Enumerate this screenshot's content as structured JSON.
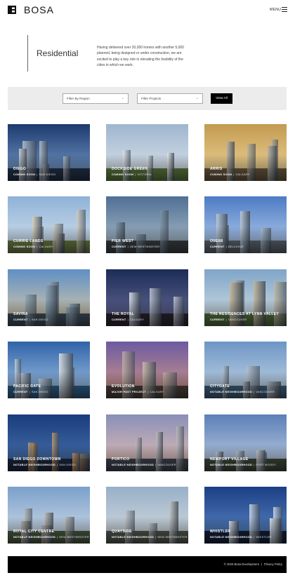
{
  "brand": {
    "logo_text": "BOSA"
  },
  "header": {
    "menu_label": "MENU"
  },
  "intro": {
    "title": "Residential",
    "text": "Having delivered over 20,000 homes with another 5,000 planned, being designed or under construction, we are excited to play a key role in elevating the livability of the cities in which we work."
  },
  "filters": {
    "region_placeholder": "Filter By Region",
    "projects_placeholder": "Filter Projects",
    "view_all_label": "View All"
  },
  "projects": [
    {
      "name": "DIEGO",
      "status": "COMING SOON",
      "city": "SAN DIEGO",
      "palette": {
        "sky_top": "#1d3a6e",
        "sky_bottom": "#7ea3cf",
        "building": "#c9cfd6",
        "ground": "#24324a"
      }
    },
    {
      "name": "DOCKSIDE GREEN",
      "status": "COMING SOON",
      "city": "VICTORIA",
      "palette": {
        "sky_top": "#9fb6cf",
        "sky_bottom": "#dfe6ec",
        "building": "#e7eaec",
        "ground": "#5d7a3f"
      }
    },
    {
      "name": "ARRIS",
      "status": "COMING SOON",
      "city": "CALGARY",
      "palette": {
        "sky_top": "#c39a4f",
        "sky_bottom": "#f1d9a0",
        "building": "#b7b2a5",
        "ground": "#6a5a3f"
      }
    },
    {
      "name": "CURRIE LANDS",
      "status": "COMING SOON",
      "city": "CALGARY",
      "palette": {
        "sky_top": "#8fb2d8",
        "sky_bottom": "#d7e4ee",
        "building": "#d8d1c0",
        "ground": "#6a7d45"
      }
    },
    {
      "name": "PIER WEST",
      "status": "CURRENT",
      "city": "NEW WESTMINSTER",
      "palette": {
        "sky_top": "#4f6f94",
        "sky_bottom": "#b4c3cf",
        "building": "#7f94a8",
        "ground": "#3b3f43"
      }
    },
    {
      "name": "ONE88",
      "status": "CURRENT",
      "city": "BELLEVUE",
      "palette": {
        "sky_top": "#4d7bc4",
        "sky_bottom": "#bcd3ee",
        "building": "#b8c8d8",
        "ground": "#5d6670"
      }
    },
    {
      "name": "SAVINA",
      "status": "CURRENT",
      "city": "SAN DIEGO",
      "palette": {
        "sky_top": "#5f8fc4",
        "sky_bottom": "#e4cfa6",
        "building": "#8aa2b4",
        "ground": "#3d4b58"
      }
    },
    {
      "name": "THE ROYAL",
      "status": "CURRENT",
      "city": "CALGARY",
      "palette": {
        "sky_top": "#1c2c56",
        "sky_bottom": "#6b6f9a",
        "building": "#d4d9e6",
        "ground": "#2b2430"
      }
    },
    {
      "name": "THE RESIDENCES AT LYNN VALLEY",
      "status": "CURRENT",
      "city": "VANCOUVER",
      "palette": {
        "sky_top": "#7fa5c8",
        "sky_bottom": "#d9e2e4",
        "building": "#c4b8a0",
        "ground": "#4f6b3c"
      }
    },
    {
      "name": "PACIFIC GATE",
      "status": "CURRENT",
      "city": "SAN DIEGO",
      "palette": {
        "sky_top": "#2f63a8",
        "sky_bottom": "#a9c9e8",
        "building": "#d6dee6",
        "ground": "#2e5c86"
      }
    },
    {
      "name": "EVOLUTION",
      "status": "MAJOR PAST PROJECT",
      "city": "CALGARY",
      "palette": {
        "sky_top": "#6c5aa1",
        "sky_bottom": "#d89b86",
        "building": "#c7b8aa",
        "ground": "#4a3e3a"
      }
    },
    {
      "name": "CITYGATE",
      "status": "NOTABLE NEIGHBOURHOOD",
      "city": "VANCOUVER",
      "palette": {
        "sky_top": "#6d96c6",
        "sky_bottom": "#c9d9e6",
        "building": "#b8c0c8",
        "ground": "#3d5e7a"
      }
    },
    {
      "name": "SAN DIEGO DOWNTOWN",
      "status": "NOTABLE NEIGHBOURHOOD",
      "city": "SAN DIEGO",
      "palette": {
        "sky_top": "#1a3c7c",
        "sky_bottom": "#4d78b2",
        "building": "#d9a66b",
        "ground": "#1d2840"
      }
    },
    {
      "name": "PORTICO",
      "status": "NOTABLE NEIGHBOURHOOD",
      "city": "VANCOUVER",
      "palette": {
        "sky_top": "#8a8fb8",
        "sky_bottom": "#e8c2b4",
        "building": "#bfbcc0",
        "ground": "#3f4450"
      }
    },
    {
      "name": "NEWPORT VILLAGE",
      "status": "NOTABLE NEIGHBOURHOOD",
      "city": "PORT MOODY",
      "palette": {
        "sky_top": "#5b7fb8",
        "sky_bottom": "#c4d2e2",
        "building": "#cfd4d8",
        "ground": "#3e4a3a"
      }
    },
    {
      "name": "ROYAL CITY CENTRE",
      "status": "NOTABLE NEIGHBOURHOOD",
      "city": "NEW WESTMINSTER",
      "palette": {
        "sky_top": "#7ba0cb",
        "sky_bottom": "#d6e0e8",
        "building": "#b9b4aa",
        "ground": "#4a5a42"
      }
    },
    {
      "name": "QUAYSIDE",
      "status": "NOTABLE NEIGHBOURHOOD",
      "city": "NEW WESTMINSTER",
      "palette": {
        "sky_top": "#98b0c8",
        "sky_bottom": "#d8dde0",
        "building": "#c3c6c6",
        "ground": "#52584e"
      }
    },
    {
      "name": "WHISTLER",
      "status": "NOTABLE NEIGHBOURHOOD",
      "city": "WHISTLER",
      "palette": {
        "sky_top": "#1c3f86",
        "sky_bottom": "#5f8cc8",
        "building": "#e8eef6",
        "ground": "#14213a"
      }
    }
  ],
  "footer": {
    "copyright": "© 2020 Bosa Development",
    "privacy_label": "Privacy Policy"
  }
}
